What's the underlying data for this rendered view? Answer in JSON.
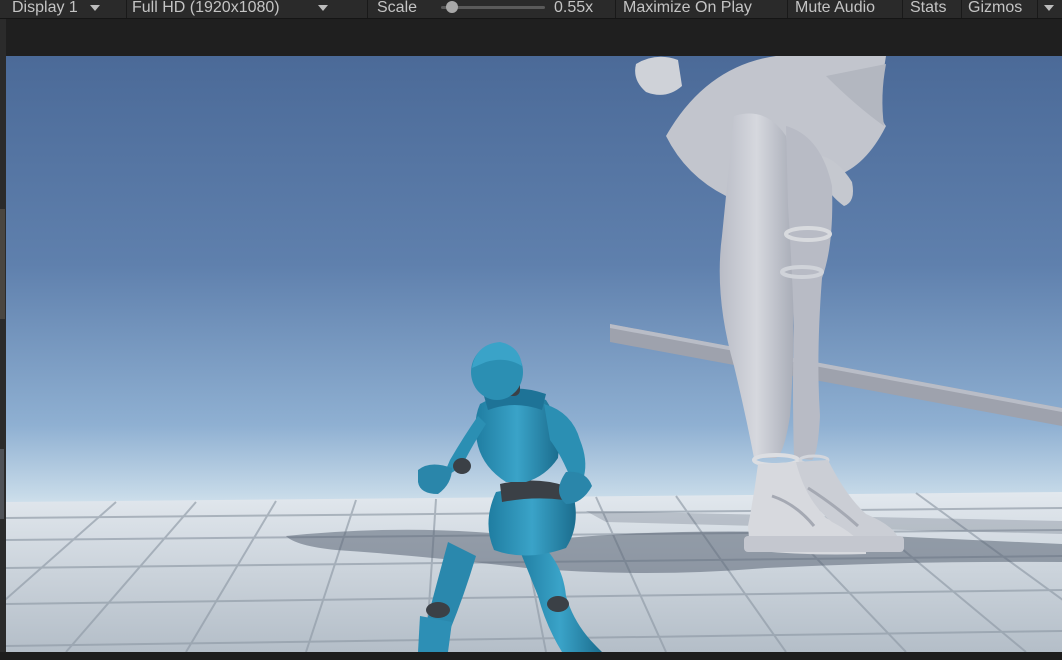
{
  "toolbar": {
    "display_label": "Display 1",
    "resolution_label": "Full HD (1920x1080)",
    "scale_label": "Scale",
    "scale_value_text": "0.55x",
    "scale_fraction": 0.05,
    "maximize_label": "Maximize On Play",
    "mute_label": "Mute Audio",
    "stats_label": "Stats",
    "gizmos_label": "Gizmos"
  },
  "colors": {
    "toolbar_bg": "#2a2a2a",
    "toolbar_text": "#c4c4c4",
    "sky_top": "#4d6b98",
    "sky_horizon": "#e6f0f6",
    "floor": "#c7cfd8",
    "player_body": "#2b8fb3",
    "player_joints": "#3a3f45",
    "statue": "#c9ccd3"
  },
  "icons": {
    "dropdown": "chevron-down-icon",
    "slider": "slider-knob-icon"
  }
}
